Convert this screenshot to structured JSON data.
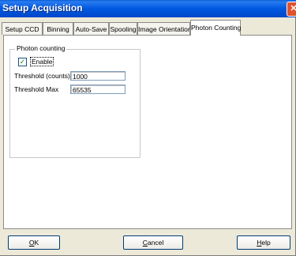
{
  "window": {
    "title": "Setup Acquisition"
  },
  "tabs": [
    {
      "label": "Setup CCD"
    },
    {
      "label": "Binning"
    },
    {
      "label": "Auto-Save"
    },
    {
      "label": "Spooling"
    },
    {
      "label": "Image Orientation"
    },
    {
      "label": "Photon Counting",
      "active": true
    }
  ],
  "photon_counting": {
    "group_title": "Photon counting",
    "enable_label": "Enable",
    "enable_checked": true,
    "threshold_label": "Threshold (counts)",
    "threshold_value": "1000",
    "threshold_max_label": "Threshold Max",
    "threshold_max_value": "65535"
  },
  "buttons": {
    "ok": {
      "underline": "O",
      "rest": "K"
    },
    "cancel": {
      "underline": "C",
      "rest": "ancel"
    },
    "help": {
      "underline": "H",
      "rest": "elp"
    }
  }
}
